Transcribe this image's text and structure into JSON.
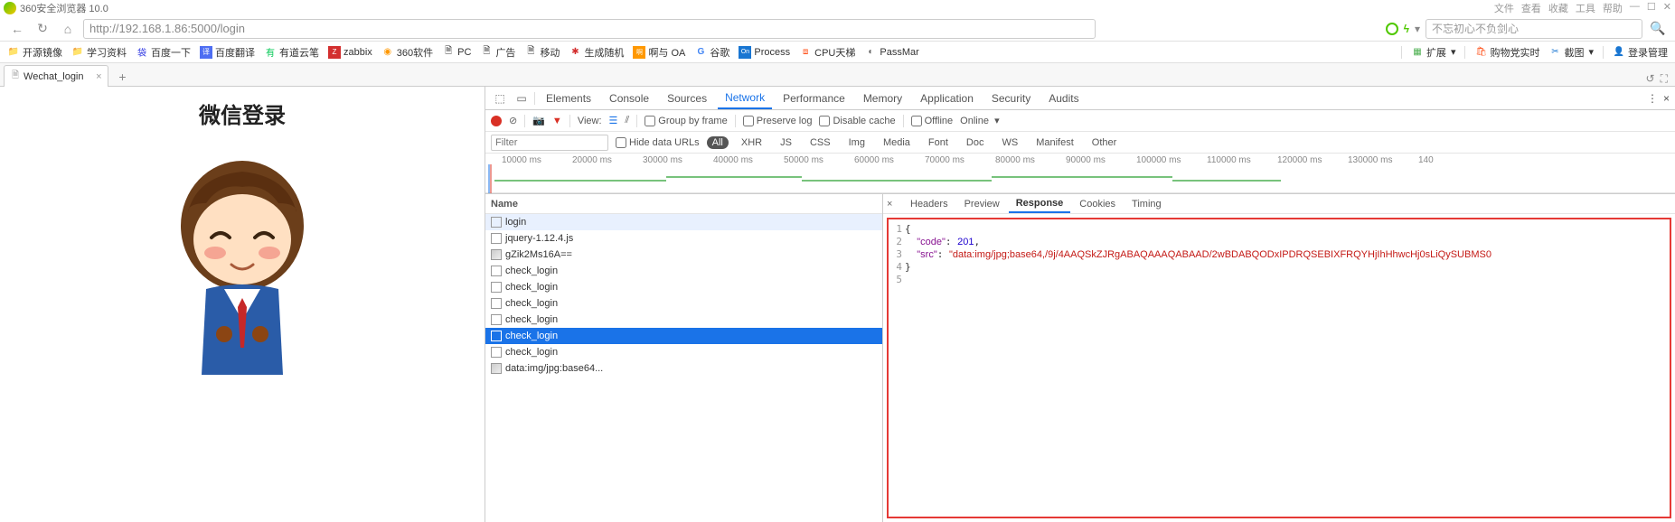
{
  "title_bar": {
    "app_name": "360安全浏览器 10.0",
    "menu": [
      "文件",
      "查看",
      "收藏",
      "工具",
      "帮助"
    ]
  },
  "nav": {
    "url": "http://192.168.1.86:5000/login",
    "search_placeholder": "不忘初心不负剑心"
  },
  "bookmarks_left": [
    {
      "icon": "folder",
      "label": "开源镜像"
    },
    {
      "icon": "folder",
      "label": "学习资料"
    },
    {
      "icon": "baidu",
      "label": "百度一下"
    },
    {
      "icon": "fanyi",
      "label": "百度翻译"
    },
    {
      "icon": "youdao",
      "label": "有道云笔"
    },
    {
      "icon": "zabbix",
      "label": "zabbix"
    },
    {
      "icon": "360",
      "label": "360软件"
    },
    {
      "icon": "page",
      "label": "PC"
    },
    {
      "icon": "page",
      "label": "广告"
    },
    {
      "icon": "page",
      "label": "移动"
    },
    {
      "icon": "gen",
      "label": "生成随机"
    },
    {
      "icon": "oa",
      "label": "啊与 OA"
    },
    {
      "icon": "google",
      "label": "谷歌"
    },
    {
      "icon": "process",
      "label": "Process"
    },
    {
      "icon": "cpu",
      "label": "CPU天梯"
    },
    {
      "icon": "pass",
      "label": "PassMar"
    }
  ],
  "bookmarks_right": [
    {
      "icon": "ext",
      "label": "扩展"
    },
    {
      "icon": "shop",
      "label": "购物党实时"
    },
    {
      "icon": "shot",
      "label": "截图"
    },
    {
      "icon": "login",
      "label": "登录管理"
    }
  ],
  "tab": {
    "title": "Wechat_login"
  },
  "page": {
    "heading": "微信登录"
  },
  "devtools": {
    "panels": [
      "Elements",
      "Console",
      "Sources",
      "Network",
      "Performance",
      "Memory",
      "Application",
      "Security",
      "Audits"
    ],
    "active_panel": "Network",
    "toolbar": {
      "view_label": "View:",
      "group": "Group by frame",
      "preserve": "Preserve log",
      "disable_cache": "Disable cache",
      "offline": "Offline",
      "online": "Online"
    },
    "filter": {
      "placeholder": "Filter",
      "hide_data": "Hide data URLs",
      "types": [
        "All",
        "XHR",
        "JS",
        "CSS",
        "Img",
        "Media",
        "Font",
        "Doc",
        "WS",
        "Manifest",
        "Other"
      ]
    },
    "timeline_labels": [
      "10000 ms",
      "20000 ms",
      "30000 ms",
      "40000 ms",
      "50000 ms",
      "60000 ms",
      "70000 ms",
      "80000 ms",
      "90000 ms",
      "100000 ms",
      "110000 ms",
      "120000 ms",
      "130000 ms",
      "140"
    ],
    "requests_header": "Name",
    "requests": [
      {
        "name": "login",
        "type": "doc",
        "state": "hover"
      },
      {
        "name": "jquery-1.12.4.js",
        "type": "doc"
      },
      {
        "name": "gZik2Ms16A==",
        "type": "img"
      },
      {
        "name": "check_login",
        "type": "doc"
      },
      {
        "name": "check_login",
        "type": "doc"
      },
      {
        "name": "check_login",
        "type": "doc"
      },
      {
        "name": "check_login",
        "type": "doc"
      },
      {
        "name": "check_login",
        "type": "doc",
        "state": "selected"
      },
      {
        "name": "check_login",
        "type": "doc"
      },
      {
        "name": "data:img/jpg:base64...",
        "type": "img"
      }
    ],
    "detail_tabs": [
      "Headers",
      "Preview",
      "Response",
      "Cookies",
      "Timing"
    ],
    "detail_active": "Response",
    "response": {
      "code_key": "\"code\"",
      "code_val": "201",
      "src_key": "\"src\"",
      "src_val": "\"data:img/jpg;base64,/9j/4AAQSkZJRgABAQAAAQABAAD/2wBDABQODxIPDRQSEBIXFRQYHjIhHhwcHj0sLiQySUBMS0"
    }
  }
}
